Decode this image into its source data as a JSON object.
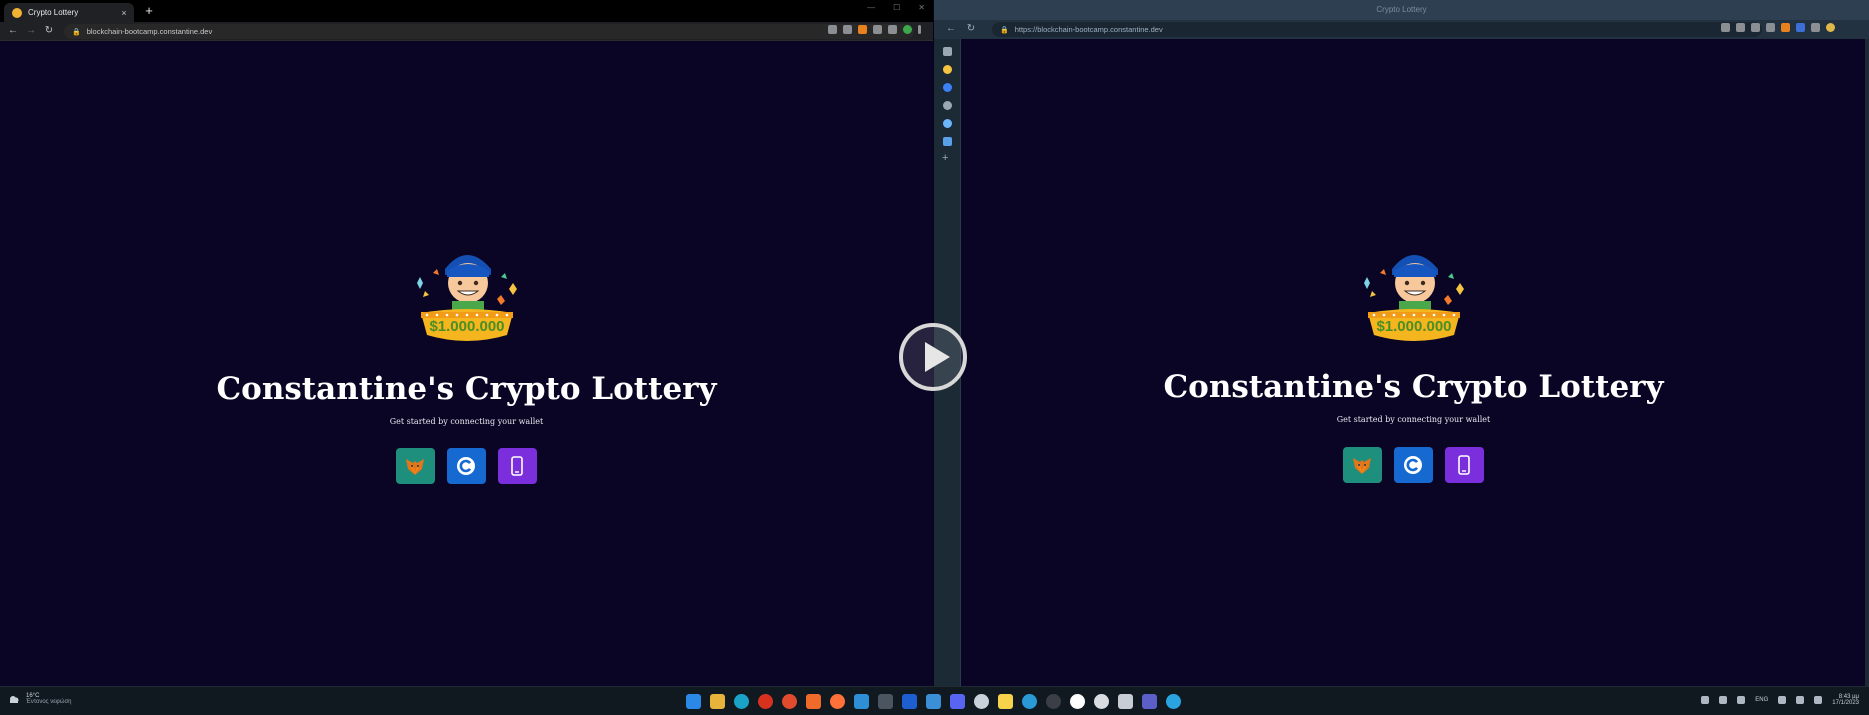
{
  "chrome": {
    "tab_title": "Crypto Lottery",
    "tab_close": "×",
    "new_tab": "+",
    "url": "blockchain-bootcamp.constantine.dev",
    "win_controls": [
      "—",
      "☐",
      "✕"
    ]
  },
  "edge": {
    "title": "Crypto Lottery",
    "url": "https://blockchain-bootcamp.constantine.dev"
  },
  "page": {
    "headline": "Constantine's Crypto Lottery",
    "tagline": "Get started by connecting your wallet",
    "prize_text": "$1.000.000",
    "wallets": [
      {
        "name": "metamask",
        "color": "#1e8f7c"
      },
      {
        "name": "coinbase",
        "color": "#1569d0"
      },
      {
        "name": "walletconnect-mobile",
        "color": "#7b2fdc"
      }
    ]
  },
  "taskbar": {
    "weather_temp": "16°C",
    "weather_condition": "Έντονος νεφώση",
    "language": "ENG",
    "time": "8:43 μμ",
    "date": "17/1/2023"
  },
  "colors": {
    "page_bg": "#0a0524",
    "headline": "#ffffff"
  }
}
